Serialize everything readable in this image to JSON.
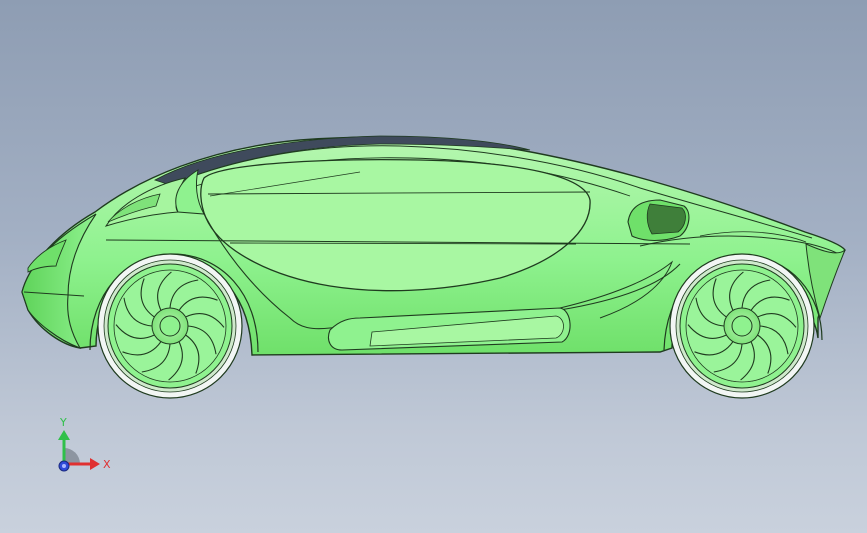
{
  "viewport": {
    "background_top": "#8e9db3",
    "background_bottom": "#c9d1dd"
  },
  "model": {
    "body_color": "#8ff28f",
    "body_highlight": "#b6f7b0",
    "body_shadow": "#5fd35a",
    "outline_color": "#1f3b1f",
    "roof_stripe_color": "#3f4a5c",
    "tire_color": "#f2f6f4"
  },
  "triad": {
    "x_label": "X",
    "y_label": "Y",
    "x_color": "#e03030",
    "y_color": "#2fc04a",
    "z_color": "#2f4ad8"
  }
}
